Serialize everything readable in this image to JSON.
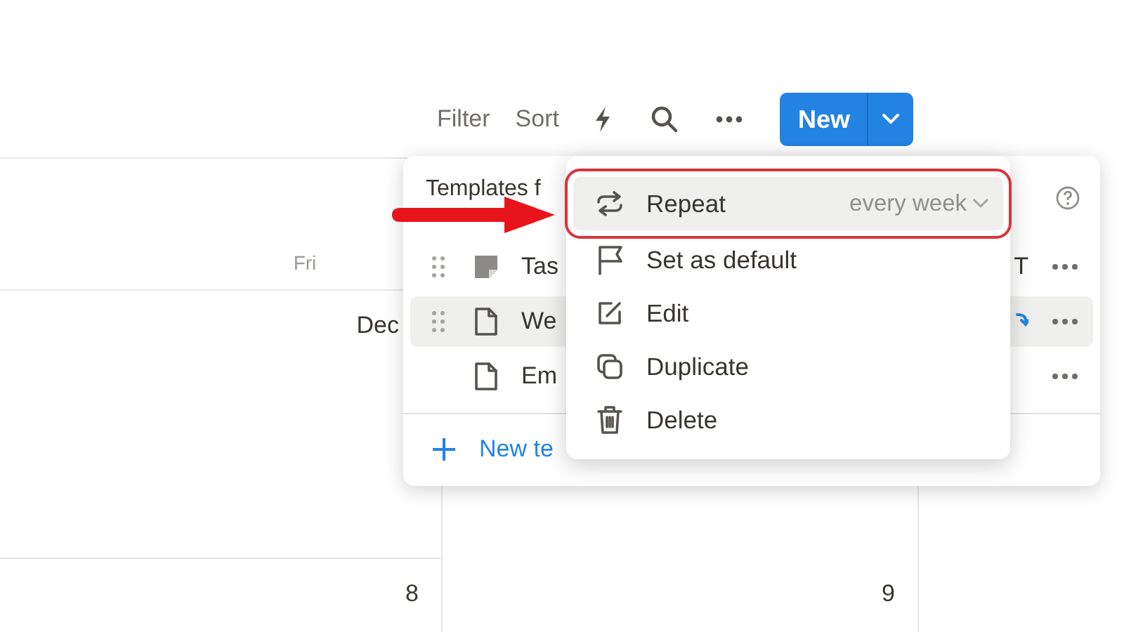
{
  "toolbar": {
    "items": [
      {
        "kind": "text",
        "label": "Filter"
      },
      {
        "kind": "text",
        "label": "Sort"
      },
      {
        "kind": "bolt"
      },
      {
        "kind": "search"
      },
      {
        "kind": "more"
      }
    ],
    "new_button": "New"
  },
  "calendar": {
    "day_header": "Fri",
    "month_label": "Dec",
    "day_numbers": [
      "8",
      "9"
    ]
  },
  "templates_popup": {
    "title": "Templates f",
    "rows": [
      {
        "name": "Tas",
        "kind": "note",
        "draggable": true,
        "selected": false,
        "repeating": false,
        "suffix": "T"
      },
      {
        "name": "We",
        "kind": "page",
        "draggable": true,
        "selected": true,
        "repeating": true
      },
      {
        "name": "Em",
        "kind": "page",
        "draggable": false,
        "selected": false,
        "repeating": false
      }
    ],
    "new_template": "New te"
  },
  "context_menu": {
    "items": [
      {
        "kind": "repeat",
        "label": "Repeat",
        "value": "every week",
        "highlighted": true
      },
      {
        "kind": "flag",
        "label": "Set as default",
        "highlighted": false
      },
      {
        "kind": "edit",
        "label": "Edit",
        "highlighted": false
      },
      {
        "kind": "duplicate",
        "label": "Duplicate",
        "highlighted": false
      },
      {
        "kind": "trash",
        "label": "Delete",
        "highlighted": false
      }
    ]
  }
}
